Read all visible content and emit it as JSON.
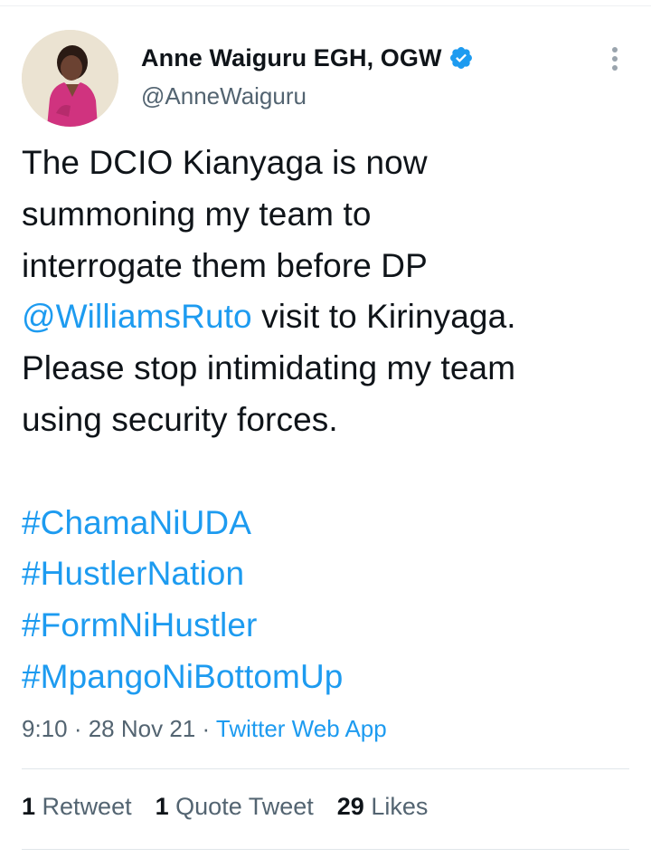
{
  "author": {
    "name": "Anne Waiguru EGH, OGW",
    "handle": "@AnneWaiguru",
    "verified": true
  },
  "tweet": {
    "lines": [
      {
        "text": "The DCIO Kianyaga is now"
      },
      {
        "text": "summoning my team to"
      },
      {
        "text": "interrogate them before DP"
      },
      {
        "mention": "@WilliamsRuto",
        "text": " visit to Kirinyaga."
      },
      {
        "text": "Please stop intimidating my team"
      },
      {
        "text": "using security forces."
      }
    ],
    "hashtags": [
      "#ChamaNiUDA",
      "#HustlerNation",
      "#FormNiHustler",
      "#MpangoNiBottomUp"
    ]
  },
  "meta": {
    "time": "9:10",
    "sep1": " · ",
    "date": "28 Nov 21",
    "sep2": " · ",
    "source": "Twitter Web App"
  },
  "stats": {
    "retweets_count": "1",
    "retweets_label": "Retweet",
    "quotes_count": "1",
    "quotes_label": "Quote Tweet",
    "likes_count": "29",
    "likes_label": "Likes"
  },
  "colors": {
    "link": "#1d9bf0",
    "text": "#0f1419",
    "muted": "#536471",
    "verified_badge": "#1d9bf0"
  },
  "icons": [
    "verified-badge-icon",
    "more-options-icon"
  ]
}
